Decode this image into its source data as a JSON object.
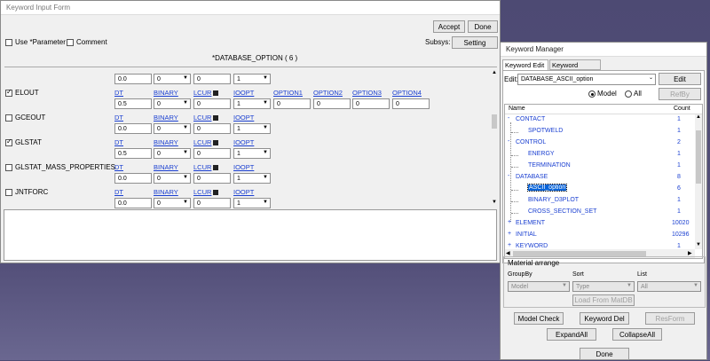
{
  "input_form": {
    "title": "Keyword Input Form",
    "accept": "Accept",
    "done": "Done",
    "use_parameter": "Use *Parameter",
    "comment": "Comment",
    "subsys": "Subsys:",
    "setting": "Setting",
    "keyword_title": "*DATABASE_OPTION    ( 6 )",
    "head_row": {
      "dt": "0.0",
      "binary": "0",
      "lcur": "0",
      "ioopt": "1"
    },
    "headers": {
      "dt": "DT",
      "binary": "BINARY",
      "lcur": "LCUR",
      "ioopt": "IOOPT",
      "opt1": "OPTION1",
      "opt2": "OPTION2",
      "opt3": "OPTION3",
      "opt4": "OPTION4"
    },
    "rows": [
      {
        "label": "ELOUT",
        "checked": true,
        "dt": "0.5",
        "binary": "0",
        "lcur": "0",
        "ioopt": "1",
        "opts": [
          "0",
          "0",
          "0",
          "0"
        ]
      },
      {
        "label": "GCEOUT",
        "checked": false,
        "dt": "0.0",
        "binary": "0",
        "lcur": "0",
        "ioopt": "1"
      },
      {
        "label": "GLSTAT",
        "checked": true,
        "dt": "0.5",
        "binary": "0",
        "lcur": "0",
        "ioopt": "1"
      },
      {
        "label": "GLSTAT_MASS_PROPERTIES",
        "checked": false,
        "dt": "0.0",
        "binary": "0",
        "lcur": "0",
        "ioopt": "1"
      },
      {
        "label": "JNTFORC",
        "checked": false,
        "dt": "0.0",
        "binary": "0",
        "lcur": "0",
        "ioopt": "1"
      }
    ]
  },
  "manager": {
    "title": "Keyword Manager",
    "tabs": [
      "Keyword Edit",
      "Keyword Search"
    ],
    "edit_label": "Edit:",
    "edit_value": "DATABASE_ASCII_option",
    "edit_button": "Edit",
    "radio_model": "Model",
    "radio_all": "All",
    "refby": "RefBy",
    "col_name": "Name",
    "col_count": "Count",
    "tree": [
      {
        "name": "CONTACT",
        "count": "1",
        "level": 0,
        "exp": "-"
      },
      {
        "name": "SPOTWELD",
        "count": "1",
        "level": 1
      },
      {
        "name": "CONTROL",
        "count": "2",
        "level": 0,
        "exp": "-"
      },
      {
        "name": "ENERGY",
        "count": "1",
        "level": 1
      },
      {
        "name": "TERMINATION",
        "count": "1",
        "level": 1
      },
      {
        "name": "DATABASE",
        "count": "8",
        "level": 0,
        "exp": "-"
      },
      {
        "name": "ASCII_option",
        "count": "6",
        "level": 1,
        "selected": true
      },
      {
        "name": "BINARY_D3PLOT",
        "count": "1",
        "level": 1
      },
      {
        "name": "CROSS_SECTION_SET",
        "count": "1",
        "level": 1
      },
      {
        "name": "ELEMENT",
        "count": "10020",
        "level": 0,
        "exp": "+"
      },
      {
        "name": "INITIAL",
        "count": "10296",
        "level": 0,
        "exp": "+"
      },
      {
        "name": "KEYWORD",
        "count": "1",
        "level": 0,
        "exp": "+"
      }
    ],
    "material_arrange": "Material arrange",
    "groupby_label": "GroupBy",
    "sort_label": "Sort",
    "list_label": "List",
    "groupby_value": "Model",
    "sort_value": "Type",
    "list_value": "All",
    "load_matdb": "Load From MatDB",
    "model_check": "Model Check",
    "keyword_del": "Keyword Del",
    "resform": "ResForm",
    "expand_all": "ExpandAll",
    "collapse_all": "CollapseAll",
    "done": "Done"
  },
  "colors": {
    "selection": "#0a64d8",
    "link": "#1a3fd1"
  }
}
